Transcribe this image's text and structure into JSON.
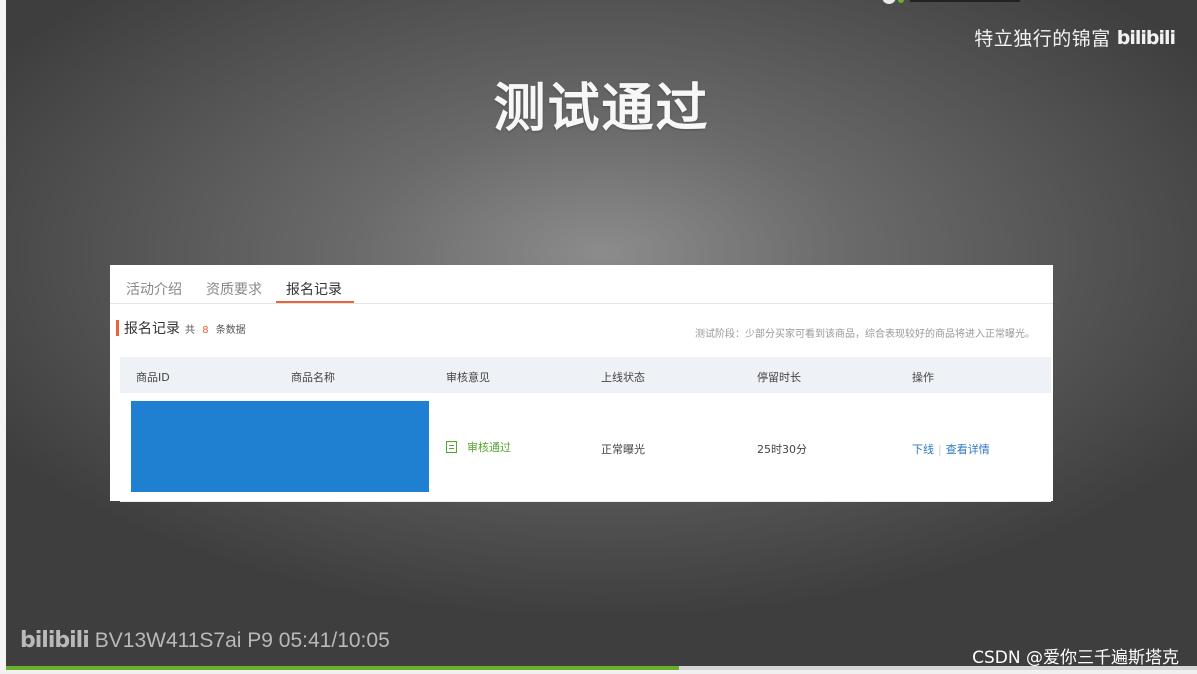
{
  "video": {
    "uploader": "特立独行的锦富",
    "platform_logo": "bilibili",
    "slide_title": "测试通过",
    "bv_info": "BV13W411S7ai P9 05:41/10:05",
    "progress": 0.565
  },
  "panel": {
    "tabs": [
      {
        "label": "活动介绍",
        "active": false
      },
      {
        "label": "资质要求",
        "active": false
      },
      {
        "label": "报名记录",
        "active": true
      }
    ],
    "section_title": "报名记录",
    "count_prefix": "共",
    "count_value": "8",
    "count_suffix": "条数据",
    "hint": "测试阶段：少部分买家可看到该商品，综合表现较好的商品将进入正常曝光。",
    "table": {
      "columns": [
        "商品ID",
        "商品名称",
        "审核意见",
        "上线状态",
        "停留时长",
        "操作"
      ],
      "rows": [
        {
          "review": "审核通过",
          "online_status": "正常曝光",
          "duration": "25时30分",
          "action_offline": "下线",
          "action_details": "查看详情"
        }
      ]
    }
  },
  "watermark": "CSDN @爱你三千遍斯塔克",
  "colors": {
    "accent": "#e8643a",
    "pass_green": "#55a532",
    "link_blue": "#2e78c7",
    "redacted_blue": "#1f7fd0",
    "progress_green": "#6ab02a"
  }
}
